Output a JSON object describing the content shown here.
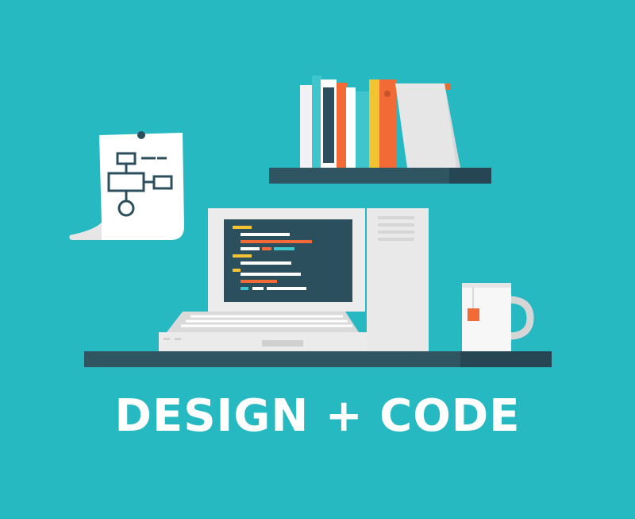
{
  "headline": "DESIGN + CODE",
  "colors": {
    "background": "#26b9c2",
    "shelf_top": "#2f5563",
    "shelf_front": "#264653",
    "screen": "#2c4f5e",
    "computer_body": "#e9e9e9",
    "accent_orange": "#f26b37",
    "accent_yellow": "#f3c332",
    "accent_teal": "#3ec6cc"
  },
  "icons": [
    "flowchart-icon",
    "laptop-icon",
    "computer-tower-icon",
    "books-icon",
    "mug-icon",
    "tea-bag-icon"
  ]
}
